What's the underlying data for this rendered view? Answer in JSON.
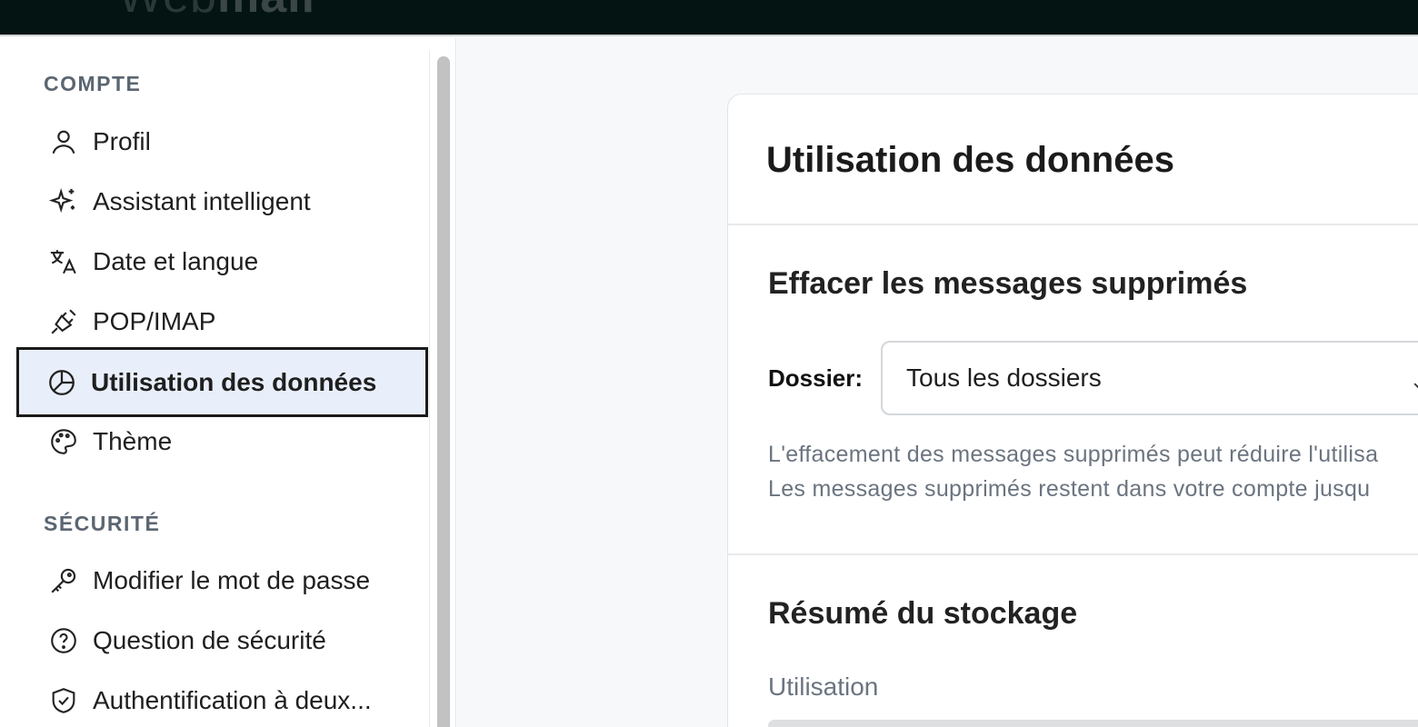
{
  "app": {
    "logo_light": "Web",
    "logo_bold": "mail"
  },
  "sidebar": {
    "sections": [
      {
        "title": "COMPTE"
      },
      {
        "title": "SÉCURITÉ"
      }
    ],
    "items": [
      {
        "label": "Profil",
        "icon": "user-icon"
      },
      {
        "label": "Assistant intelligent",
        "icon": "sparkle-icon"
      },
      {
        "label": "Date et langue",
        "icon": "translate-icon"
      },
      {
        "label": "POP/IMAP",
        "icon": "plug-icon"
      },
      {
        "label": "Utilisation des données",
        "icon": "pie-chart-icon",
        "active": true
      },
      {
        "label": "Thème",
        "icon": "palette-icon"
      },
      {
        "label": "Modifier le mot de passe",
        "icon": "key-icon"
      },
      {
        "label": "Question de sécurité",
        "icon": "question-icon"
      },
      {
        "label": "Authentification à deux...",
        "icon": "shield-check-icon"
      }
    ]
  },
  "main": {
    "title": "Utilisation des données",
    "delete_section": {
      "title": "Effacer les messages supprimés",
      "folder_label": "Dossier:",
      "folder_value": "Tous les dossiers",
      "help_line_1": "L'effacement des messages supprimés peut réduire l'utilisa",
      "help_line_2": "Les messages supprimés restent dans votre compte jusqu"
    },
    "storage_section": {
      "title": "Résumé du stockage",
      "usage_label": "Utilisation"
    }
  },
  "colors": {
    "topbar": "#031412",
    "active_bg": "#e9effa",
    "muted_text": "#6b7480",
    "section_title": "#5b6671"
  }
}
